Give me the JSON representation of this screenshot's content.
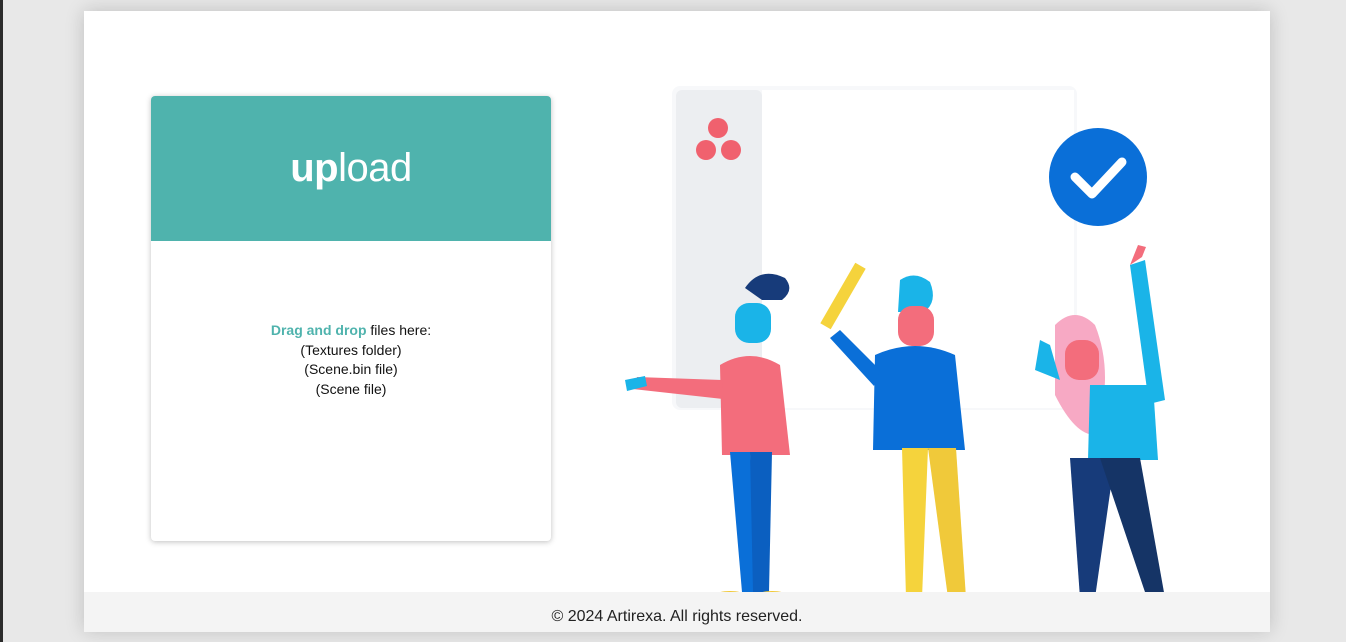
{
  "upload": {
    "title_bold": "up",
    "title_light": "load",
    "drop_emphasis": "Drag and drop",
    "drop_rest": " files here:",
    "lines": [
      "(Textures folder)",
      "(Scene.bin file)",
      "(Scene file)"
    ]
  },
  "footer": {
    "text": "© 2024 Artirexa. All rights reserved."
  },
  "colors": {
    "accent": "#4fb3ad",
    "check": "#0a6fd8",
    "logo": "#f0616e"
  },
  "icons": {
    "check": "checkmark-badge-icon",
    "logo": "three-dots-logo-icon"
  }
}
